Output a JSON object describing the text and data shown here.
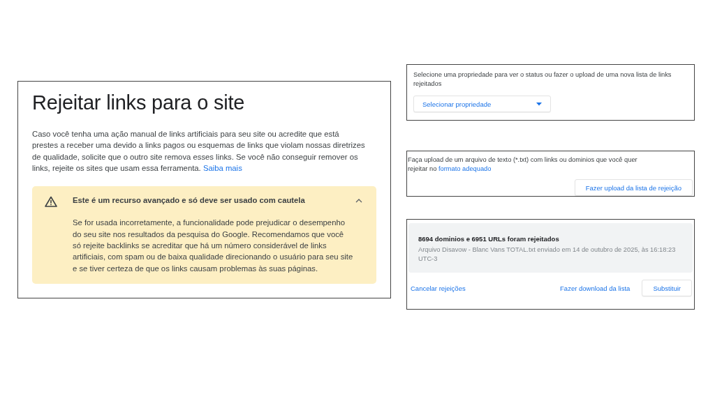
{
  "main_panel": {
    "title": "Rejeitar links para o site",
    "intro": "Caso você tenha uma ação manual de links artificiais para seu site ou acredite que está prestes a receber uma devido a links pagos ou esquemas de links que violam nossas diretrizes de qualidade, solicite que o outro site remova esses links. Se você não conseguir remover os links, rejeite os sites que usam essa ferramenta.",
    "learn_more": "Saiba mais",
    "warning": {
      "title": "Este é um recurso avançado e só deve ser usado com cautela",
      "expanded": true,
      "body": "Se for usada incorretamente, a funcionalidade pode prejudicar o desempenho do seu site nos resultados da pesquisa do Google. Recomendamos que você só rejeite backlinks se acreditar que há um número considerável de links artificiais, com spam ou de baixa qualidade direcionando o usuário para seu site e se tiver certeza de que os links causam problemas às suas páginas."
    }
  },
  "property_panel": {
    "text": "Selecione uma propriedade para ver o status ou fazer o upload de uma nova lista de links rejeitados",
    "dropdown": "Selecionar propriedade"
  },
  "upload_panel": {
    "text": "Faça upload de um arquivo de texto (*.txt) com links ou dominios que você quer rejeitar no",
    "link": "formato adequado",
    "button": "Fazer upload da lista de rejeição"
  },
  "status_panel": {
    "summary": "8694 dominios e 6951 URLs foram rejeitados",
    "detail": "Arquivo Disavow - Blanc Vans TOTAL.txt enviado em 14 de outubro de 2025, às 16:18:23 UTC-3",
    "cancel": "Cancelar rejeições",
    "download": "Fazer download da lista",
    "replace": "Substituir"
  }
}
